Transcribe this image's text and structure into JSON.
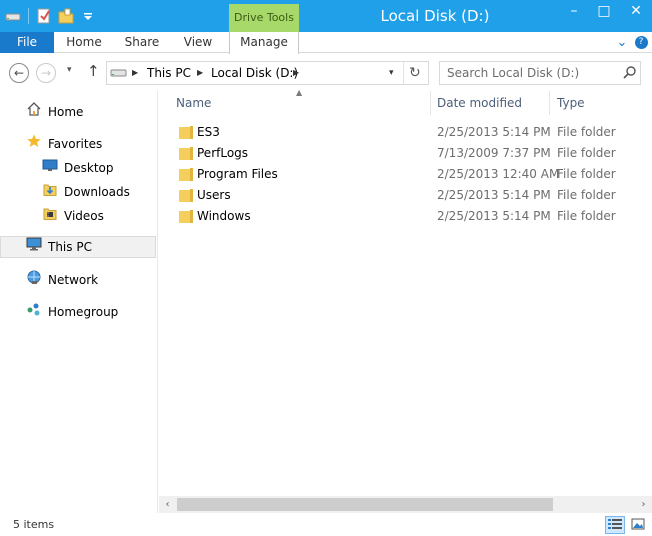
{
  "window": {
    "title": "Local Disk (D:)",
    "contextual_tab": "Drive Tools",
    "minimize_symbol": "–",
    "maximize_symbol": "□",
    "close_symbol": "✕"
  },
  "ribbon": {
    "file_tab": "File",
    "tabs": [
      "Home",
      "Share",
      "View",
      "Manage"
    ],
    "collapse_symbol": "⌄",
    "help_symbol": "?"
  },
  "address": {
    "crumbs": [
      "This PC",
      "Local Disk (D:)"
    ],
    "refresh_symbol": "↻"
  },
  "search": {
    "placeholder": "Search Local Disk (D:)"
  },
  "nav": {
    "back_symbol": "←",
    "forward_symbol": "→",
    "recent_symbol": "▾",
    "up_symbol": "↑",
    "items": [
      {
        "label": "Home",
        "icon": "home-icon"
      },
      {
        "label": "Favorites",
        "icon": "star-icon"
      },
      {
        "label": "Desktop",
        "icon": "desktop-icon"
      },
      {
        "label": "Downloads",
        "icon": "downloads-icon"
      },
      {
        "label": "Videos",
        "icon": "videos-icon"
      },
      {
        "label": "This PC",
        "icon": "computer-icon"
      },
      {
        "label": "Network",
        "icon": "network-icon"
      },
      {
        "label": "Homegroup",
        "icon": "homegroup-icon"
      }
    ]
  },
  "filelist": {
    "columns": {
      "name": "Name",
      "date": "Date modified",
      "type": "Type"
    },
    "sort_symbol": "▲",
    "rows": [
      {
        "name": "ES3",
        "date": "2/25/2013 5:14 PM",
        "type": "File folder"
      },
      {
        "name": "PerfLogs",
        "date": "7/13/2009 7:37 PM",
        "type": "File folder"
      },
      {
        "name": "Program Files",
        "date": "2/25/2013 12:40 AM",
        "type": "File folder"
      },
      {
        "name": "Users",
        "date": "2/25/2013 5:14 PM",
        "type": "File folder"
      },
      {
        "name": "Windows",
        "date": "2/25/2013 5:14 PM",
        "type": "File folder"
      }
    ]
  },
  "scrollbar": {
    "left_symbol": "‹",
    "right_symbol": "›"
  },
  "status": {
    "item_count": "5 items"
  },
  "colors": {
    "titlebar": "#1fa0e9",
    "file_tab": "#1979ca",
    "contextual_tab": "#a6d96a",
    "folder": "#f5cf5e",
    "column_header_text": "#4c607a"
  }
}
